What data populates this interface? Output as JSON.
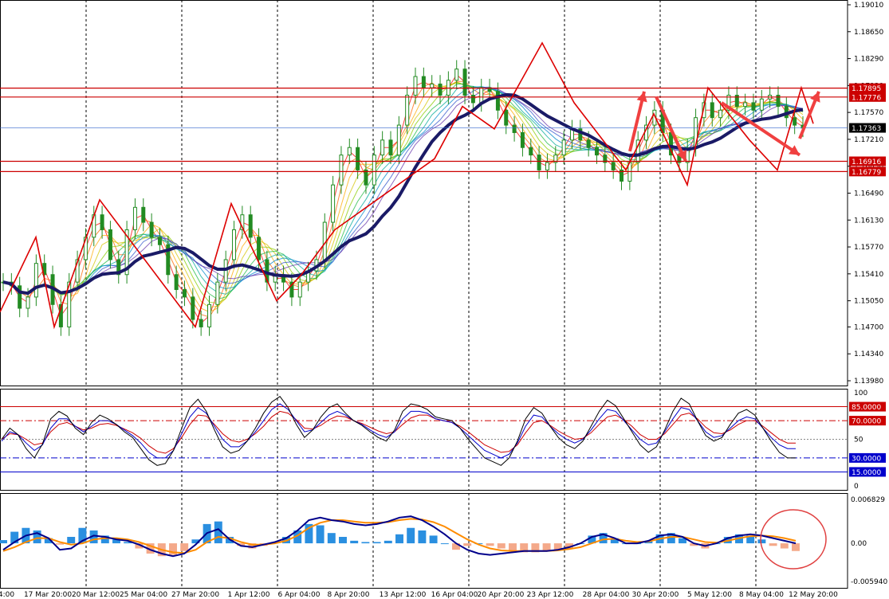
{
  "chart_data": {
    "type": "line",
    "colors": {
      "price_axis_highlight": "#cc0000",
      "current_price_box": "#000000",
      "candle": "#228B22",
      "slow_ma": "#1a1a66",
      "zigzag": "#dd0000",
      "stoch_main": "#000000",
      "stoch_blue": "#0000cc",
      "stoch_red": "#cc0000",
      "macd_pos": "#2a8fe0",
      "macd_neg": "#f4a98a",
      "macd_line": "#00008b",
      "signal_line": "#ff8c00",
      "level_red": "#cc0000",
      "level_blue": "#0000cc"
    },
    "price_panel": {
      "ylim": [
        1.1398,
        1.1901
      ],
      "y_ticks": [
        "1.19010",
        "1.18650",
        "1.18290",
        "1.17930",
        "1.17570",
        "1.17210",
        "1.16850",
        "1.16490",
        "1.16130",
        "1.15770",
        "1.15410",
        "1.15050",
        "1.14700",
        "1.14340",
        "1.13980"
      ],
      "levels": [
        {
          "label": "1.17895",
          "value": 1.17895,
          "color": "#cc0000",
          "box": true
        },
        {
          "label": "1.17776",
          "value": 1.17776,
          "color": "#cc0000",
          "box": true
        },
        {
          "label": "1.17363",
          "value": 1.17363,
          "color": "#000000",
          "box": true,
          "current": true
        },
        {
          "label": "1.16916",
          "value": 1.16916,
          "color": "#cc0000",
          "box": true
        },
        {
          "label": "1.16779",
          "value": 1.16779,
          "color": "#cc0000",
          "box": true
        }
      ],
      "close": [
        1.153,
        1.1525,
        1.1495,
        1.151,
        1.1555,
        1.154,
        1.15,
        1.147,
        1.153,
        1.156,
        1.159,
        1.162,
        1.16,
        1.156,
        1.154,
        1.16,
        1.163,
        1.161,
        1.159,
        1.158,
        1.154,
        1.152,
        1.151,
        1.148,
        1.147,
        1.15,
        1.153,
        1.156,
        1.16,
        1.162,
        1.159,
        1.156,
        1.153,
        1.154,
        1.153,
        1.151,
        1.153,
        1.1545,
        1.156,
        1.161,
        1.166,
        1.17,
        1.171,
        1.168,
        1.166,
        1.17,
        1.172,
        1.17,
        1.174,
        1.178,
        1.1805,
        1.179,
        1.1795,
        1.178,
        1.18,
        1.1815,
        1.178,
        1.177,
        1.179,
        1.1785,
        1.176,
        1.174,
        1.173,
        1.171,
        1.17,
        1.168,
        1.169,
        1.17,
        1.172,
        1.1735,
        1.172,
        1.171,
        1.17,
        1.169,
        1.168,
        1.1665,
        1.169,
        1.172,
        1.174,
        1.176,
        1.173,
        1.17,
        1.169,
        1.171,
        1.175,
        1.177,
        1.175,
        1.176,
        1.178,
        1.1765,
        1.177,
        1.176,
        1.1775,
        1.178,
        1.1765,
        1.175,
        1.174,
        1.1736
      ],
      "zigzag": [
        [
          0,
          1.149
        ],
        [
          1,
          1.159
        ],
        [
          3,
          1.147
        ],
        [
          5,
          1.164
        ],
        [
          11,
          1.147
        ],
        [
          13,
          1.1635
        ],
        [
          19,
          1.1505
        ],
        [
          21,
          1.154
        ],
        [
          23,
          1.16
        ],
        [
          28,
          1.1695
        ],
        [
          36,
          1.1765
        ],
        [
          40,
          1.1735
        ],
        [
          48,
          1.185
        ],
        [
          58,
          1.177
        ],
        [
          67,
          1.168
        ],
        [
          72,
          1.1755
        ],
        [
          78,
          1.166
        ],
        [
          84,
          1.179
        ],
        [
          86,
          1.172
        ],
        [
          90,
          1.168
        ],
        [
          92,
          1.179
        ],
        [
          98,
          1.1742
        ]
      ],
      "zigzag_x": [
        0,
        45,
        68,
        125,
        245,
        290,
        347,
        378,
        420,
        545,
        580,
        620,
        680,
        720,
        785,
        820,
        862,
        888,
        940,
        975,
        1005,
        1020
      ],
      "arrows": [
        {
          "from": [
            790,
            1.1705
          ],
          "to": [
            808,
            1.1785
          ]
        },
        {
          "from": [
            823,
            1.1778
          ],
          "to": [
            860,
            1.1692
          ]
        },
        {
          "from": [
            905,
            1.177
          ],
          "to": [
            1003,
            1.17
          ]
        },
        {
          "from": [
            1003,
            1.1722
          ],
          "to": [
            1027,
            1.1785
          ]
        }
      ]
    },
    "stoch_panel": {
      "ylim": [
        0,
        100
      ],
      "y_ticks": [
        "100",
        "50",
        "0"
      ],
      "levels": [
        {
          "label": "85.0000",
          "value": 85,
          "color": "#cc0000",
          "style": "solid",
          "box": true
        },
        {
          "label": "70.0000",
          "value": 70,
          "color": "#cc0000",
          "style": "dashdot",
          "box": true
        },
        {
          "label": "30.0000",
          "value": 30,
          "color": "#0000cc",
          "style": "dashdot",
          "box": true
        },
        {
          "label": "15.0000",
          "value": 15,
          "color": "#0000cc",
          "style": "solid",
          "box": true
        }
      ],
      "main": [
        50,
        62,
        55,
        40,
        30,
        45,
        72,
        80,
        75,
        62,
        55,
        68,
        76,
        72,
        66,
        58,
        52,
        40,
        28,
        22,
        24,
        38,
        62,
        84,
        93,
        80,
        60,
        42,
        35,
        38,
        48,
        62,
        78,
        90,
        96,
        84,
        66,
        52,
        60,
        74,
        84,
        88,
        78,
        70,
        65,
        58,
        52,
        48,
        60,
        80,
        88,
        86,
        82,
        74,
        72,
        70,
        62,
        50,
        40,
        30,
        26,
        22,
        30,
        48,
        72,
        84,
        78,
        64,
        52,
        44,
        40,
        48,
        64,
        80,
        92,
        86,
        72,
        58,
        44,
        36,
        42,
        60,
        80,
        94,
        88,
        70,
        54,
        48,
        52,
        66,
        78,
        82,
        76,
        62,
        48,
        36,
        30,
        30
      ],
      "blue": [
        48,
        58,
        55,
        46,
        38,
        44,
        62,
        72,
        72,
        64,
        58,
        64,
        70,
        70,
        66,
        60,
        54,
        46,
        36,
        30,
        30,
        38,
        56,
        74,
        84,
        78,
        64,
        50,
        42,
        42,
        48,
        58,
        70,
        82,
        88,
        82,
        70,
        58,
        60,
        68,
        76,
        80,
        76,
        70,
        66,
        60,
        55,
        52,
        58,
        72,
        80,
        80,
        78,
        72,
        70,
        68,
        62,
        54,
        46,
        38,
        34,
        30,
        34,
        46,
        64,
        76,
        74,
        64,
        56,
        50,
        46,
        50,
        60,
        72,
        82,
        80,
        70,
        60,
        50,
        44,
        46,
        58,
        72,
        84,
        82,
        70,
        58,
        52,
        54,
        62,
        70,
        74,
        72,
        62,
        52,
        44,
        40,
        40
      ],
      "red": [
        50,
        56,
        55,
        50,
        44,
        46,
        58,
        66,
        68,
        64,
        60,
        62,
        66,
        67,
        65,
        61,
        57,
        51,
        43,
        37,
        35,
        40,
        52,
        66,
        76,
        75,
        66,
        56,
        49,
        47,
        50,
        56,
        64,
        74,
        80,
        78,
        71,
        62,
        61,
        65,
        71,
        75,
        74,
        70,
        67,
        63,
        59,
        56,
        58,
        66,
        73,
        76,
        76,
        72,
        70,
        68,
        64,
        58,
        51,
        44,
        40,
        36,
        37,
        44,
        57,
        68,
        70,
        65,
        59,
        54,
        50,
        51,
        57,
        66,
        74,
        76,
        71,
        64,
        55,
        50,
        50,
        56,
        66,
        76,
        78,
        72,
        63,
        57,
        56,
        60,
        66,
        70,
        70,
        64,
        57,
        50,
        46,
        46
      ]
    },
    "macd_panel": {
      "y_ticks": [
        "0.006829",
        "0.00",
        "-0.005940"
      ],
      "ylim": [
        -0.00594,
        0.006829
      ],
      "hist": [
        0.0005,
        0.0018,
        0.0024,
        0.002,
        0.0008,
        -0.0002,
        0.001,
        0.0024,
        0.002,
        0.0012,
        0.0006,
        0.0002,
        -0.0008,
        -0.0016,
        -0.002,
        -0.0018,
        -0.0012,
        0.0006,
        0.003,
        0.0034,
        0.001,
        -0.0004,
        -0.0008,
        -0.0004,
        0.0002,
        0.001,
        0.002,
        0.003,
        0.0028,
        0.0016,
        0.001,
        0.0004,
        0.0002,
        0.0002,
        0.0004,
        0.0014,
        0.0024,
        0.002,
        0.0012,
        0.0,
        -0.001,
        -0.0004,
        0.0,
        -0.0004,
        -0.0008,
        -0.0012,
        -0.0014,
        -0.0014,
        -0.0012,
        -0.001,
        -0.0008,
        0.0,
        0.0012,
        0.0016,
        0.0008,
        0.0,
        0.0,
        0.0004,
        0.0014,
        0.0016,
        0.0008,
        -0.0004,
        -0.0008,
        0.0,
        0.001,
        0.0014,
        0.0012,
        0.0006,
        -0.0004,
        -0.0008,
        -0.0012
      ],
      "macd": [
        -0.001,
        0.0002,
        0.0012,
        0.0016,
        0.0008,
        -0.001,
        -0.0008,
        0.0004,
        0.0012,
        0.001,
        0.0006,
        0.0004,
        -0.0002,
        -0.001,
        -0.0016,
        -0.002,
        -0.0016,
        -0.0002,
        0.0016,
        0.0022,
        0.0006,
        -0.0004,
        -0.0006,
        -0.0002,
        0.0002,
        0.0008,
        0.002,
        0.0036,
        0.004,
        0.0036,
        0.0034,
        0.003,
        0.0028,
        0.003,
        0.0034,
        0.004,
        0.0042,
        0.0036,
        0.0026,
        0.0014,
        0.0,
        -0.001,
        -0.0016,
        -0.0018,
        -0.0016,
        -0.0014,
        -0.0012,
        -0.0012,
        -0.0012,
        -0.001,
        -0.0006,
        0.0,
        0.001,
        0.0014,
        0.0008,
        0.0,
        0.0,
        0.0004,
        0.0012,
        0.0014,
        0.001,
        0.0,
        -0.0004,
        0.0,
        0.0008,
        0.0012,
        0.0014,
        0.0012,
        0.0008,
        0.0004,
        0.0
      ],
      "signal": [
        -0.0012,
        -0.0006,
        0.0002,
        0.0008,
        0.0008,
        0.0002,
        -0.0002,
        0.0,
        0.0006,
        0.0008,
        0.0008,
        0.0006,
        0.0002,
        -0.0004,
        -0.001,
        -0.0014,
        -0.0015,
        -0.001,
        0.0002,
        0.001,
        0.0008,
        0.0002,
        -0.0002,
        -0.0002,
        0.0,
        0.0004,
        0.0012,
        0.0024,
        0.0032,
        0.0036,
        0.0036,
        0.0034,
        0.0032,
        0.0032,
        0.0033,
        0.0036,
        0.0038,
        0.0037,
        0.0033,
        0.0026,
        0.0016,
        0.0006,
        -0.0002,
        -0.0008,
        -0.0011,
        -0.0012,
        -0.0012,
        -0.0012,
        -0.0012,
        -0.0011,
        -0.0009,
        -0.0006,
        0.0,
        0.0006,
        0.0007,
        0.0004,
        0.0002,
        0.0003,
        0.0007,
        0.001,
        0.001,
        0.0006,
        0.0002,
        0.0001,
        0.0004,
        0.0008,
        0.0011,
        0.0012,
        0.0011,
        0.0008,
        0.0004
      ]
    },
    "x_ticks": [
      "4:00",
      "17 Mar 20:00",
      "20 Mar 12:00",
      "25 Mar 04:00",
      "27 Mar 20:00",
      "1 Apr 12:00",
      "6 Apr 04:00",
      "8 Apr 20:00",
      "13 Apr 12:00",
      "16 Apr 04:00",
      "20 Apr 20:00",
      "23 Apr 12:00",
      "28 Apr 04:00",
      "30 Apr 20:00",
      "5 May 12:00",
      "8 May 04:00",
      "12 May 20:00"
    ],
    "x_tick_pos": [
      8,
      60,
      120,
      180,
      245,
      312,
      375,
      437,
      505,
      570,
      628,
      690,
      760,
      822,
      890,
      955,
      1020
    ],
    "vgrid_pos": [
      108,
      228,
      348,
      468,
      588,
      708,
      828,
      948
    ]
  }
}
